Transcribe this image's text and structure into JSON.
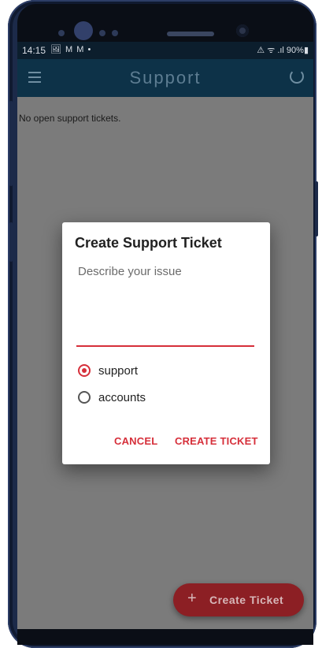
{
  "status_bar": {
    "time": "14:15",
    "notification_icons": "🖼 M M •",
    "right": "⚠ ᯤ .ıl 90%▮"
  },
  "app_bar": {
    "title": "Support",
    "menu_icon": "hamburger-menu-icon",
    "refresh_icon": "refresh-icon"
  },
  "content": {
    "empty_message": "No open support tickets."
  },
  "dialog": {
    "title": "Create Support Ticket",
    "input_placeholder": "Describe your issue",
    "input_value": "",
    "options": [
      {
        "label": "support",
        "checked": true
      },
      {
        "label": "accounts",
        "checked": false
      }
    ],
    "cancel_label": "CANCEL",
    "confirm_label": "CREATE TICKET"
  },
  "fab": {
    "icon": "+",
    "label": "Create Ticket"
  },
  "colors": {
    "accent": "#d62f3a",
    "app_bar": "#0d3248",
    "fab": "#8c1f24"
  }
}
